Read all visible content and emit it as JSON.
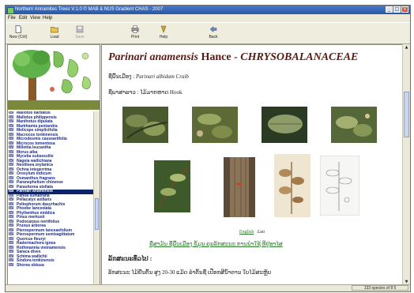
{
  "window": {
    "title": "Northern Annamites Trees V.1.0 © MAB & NUS Gradient CHAS - 2007"
  },
  "menu": {
    "items": [
      "File",
      "Edit",
      "View",
      "Help"
    ]
  },
  "toolbar": {
    "buttons": [
      {
        "label": "New (Ctrl)",
        "icon": "new-file-icon",
        "enabled": true
      },
      {
        "label": "Load",
        "icon": "open-folder-icon",
        "enabled": true
      },
      {
        "label": "Save",
        "icon": "save-icon",
        "enabled": false
      },
      {
        "label": "Print",
        "icon": "print-icon",
        "enabled": true
      },
      {
        "label": "Help",
        "icon": "help-icon",
        "enabled": true
      },
      {
        "label": "Back",
        "icon": "back-arrow-icon",
        "enabled": true
      }
    ]
  },
  "species_list": {
    "code": "IBI",
    "items": [
      "Mallotus barbatus",
      "Mallotus philippensis",
      "Manihotus dipulata",
      "Markhamia pentandra",
      "Melicope simplicifolia",
      "Macrocos tonkinensis",
      "Microdesmis casseariifolia",
      "Microcos tomentosa",
      "Millettia leucantha",
      "Morus alba",
      "Mycetia subsessilis",
      "Nageia wallichiana",
      "Neolitsea zeylanica",
      "Ochna integerrima",
      "Oroxylum indicum",
      "Osmanthus fragrans",
      "Paranephelium chinense",
      "Parashorea stellata",
      "Parinari anamensis",
      "Parkia sumatrana",
      "Pellacalyx axillaris",
      "Peltophorum dasyrhachis",
      "Phoebe lanceolata",
      "Phyllanthus emblica",
      "Pinus merkusii",
      "Podocarpus neriifolius",
      "Prunus arborea",
      "Pterospermum lanceaefolium",
      "Pterospermum semisagittatum",
      "Quercus fleuryi",
      "Radermachera ignea",
      "Rothmannia vietnamensis",
      "Saraca dives",
      "Schima wallichii",
      "Sindora tonkinensis",
      "Shorea obtusa"
    ],
    "selected_index": 18
  },
  "species": {
    "scientific_name": "Parinari anamensis",
    "author": "Hance",
    "family": "CHRYSOBALANACEAE",
    "line1_label": "ຊື່ພື້ນເມືອງ :",
    "line1_value": "Parinari albidum Craib",
    "line2_label": "ຊື່ພາສາລາວ :",
    "line2_value": "ໄມ້ມາກຫາດ Hook",
    "links": {
      "english": "English",
      "lao": "Lao"
    },
    "reference": "ຊື່ສາມັນ ຊື່ພື້ນເມືອງ ຂໍ້ມູນ ຄຸນລັກສະນະ ການນໍາໃຊ້ ທີ່ຢູ່ອາໄສ",
    "section_title": "ລັກສະນະທົ່ວໄປ :",
    "section_text": "ລັກສະນະ ໄມ້ຢືນຕົ້ນ ສູງ 20-30 ແມັດ ລໍາຕົ້ນຊື່ ເປືອກສີນໍ້າຕານ ໃບໄມ້ສະຫຼັບ"
  },
  "photos": [
    {
      "name": "leaves-photo-1",
      "color": "#4a5a2e"
    },
    {
      "name": "leaves-photo-2",
      "color": "#5d6a36"
    },
    {
      "name": "leaf-photo-3",
      "color": "#2b3a22"
    },
    {
      "name": "leaves-photo-4",
      "color": "#56683a"
    },
    {
      "name": "branch-photo",
      "color": "#3e5a2a"
    },
    {
      "name": "bark-photo",
      "color": "#7a6248"
    },
    {
      "name": "herbarium-specimen-photo",
      "color": "#b08a5a"
    },
    {
      "name": "botanical-drawing",
      "color": "#d8dcd8"
    }
  ],
  "status": {
    "text": "133 species of 8 5"
  }
}
